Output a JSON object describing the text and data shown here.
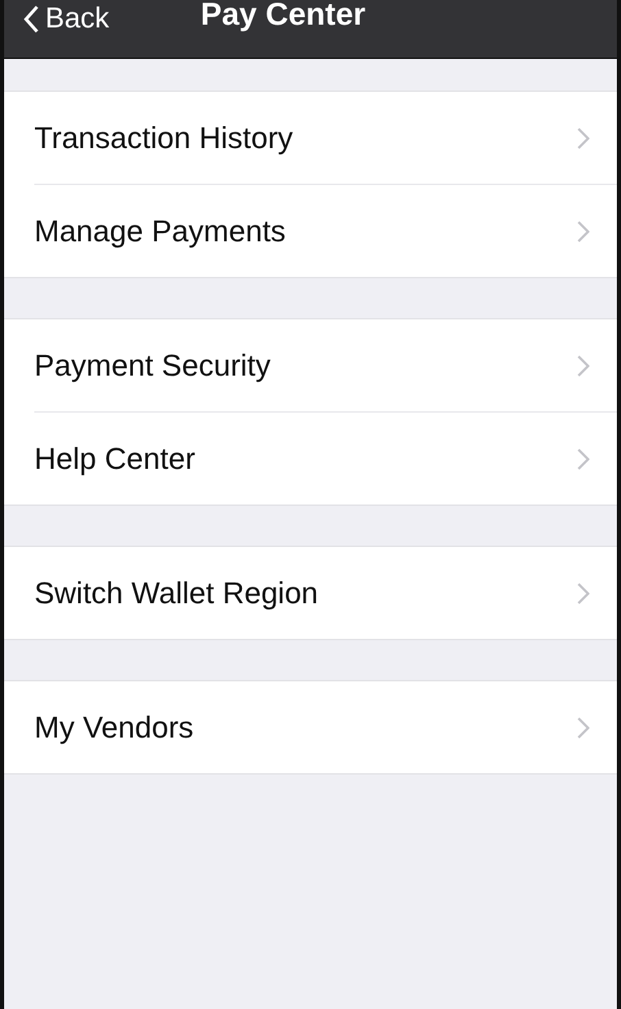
{
  "nav_bar": {
    "back_label": "Back",
    "title": "Pay Center"
  },
  "groups": [
    {
      "items": [
        "Transaction History",
        "Manage Payments"
      ]
    },
    {
      "items": [
        "Payment Security",
        "Help Center"
      ]
    },
    {
      "items": [
        "Switch Wallet Region"
      ]
    },
    {
      "items": [
        "My Vendors"
      ]
    }
  ]
}
